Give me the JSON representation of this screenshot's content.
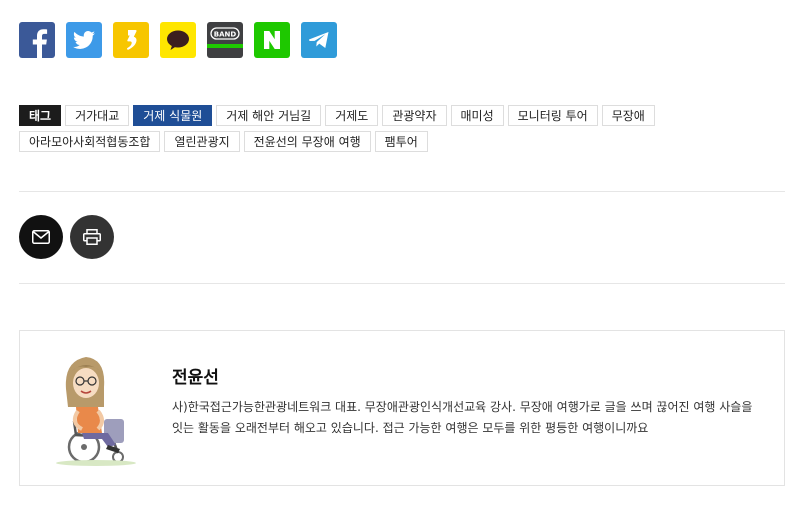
{
  "share": {
    "buttons": [
      {
        "name": "facebook",
        "icon": "facebook-icon"
      },
      {
        "name": "twitter",
        "icon": "twitter-icon"
      },
      {
        "name": "kakaostory",
        "icon": "kakaostory-icon"
      },
      {
        "name": "kakaotalk",
        "icon": "kakaotalk-icon"
      },
      {
        "name": "band",
        "icon": "band-icon",
        "text": "BAND"
      },
      {
        "name": "naver",
        "icon": "naver-icon",
        "text": "N"
      },
      {
        "name": "telegram",
        "icon": "telegram-icon"
      }
    ]
  },
  "tags": {
    "label": "태그",
    "items": [
      {
        "text": "거가대교",
        "active": false
      },
      {
        "text": "거제 식물원",
        "active": true
      },
      {
        "text": "거제 해안 거님길",
        "active": false
      },
      {
        "text": "거제도",
        "active": false
      },
      {
        "text": "관광약자",
        "active": false
      },
      {
        "text": "매미성",
        "active": false
      },
      {
        "text": "모니터링 투어",
        "active": false
      },
      {
        "text": "무장애",
        "active": false
      },
      {
        "text": "아라모아사회적협동조합",
        "active": false
      },
      {
        "text": "열린관광지",
        "active": false
      },
      {
        "text": "전윤선의 무장애 여행",
        "active": false
      },
      {
        "text": "팸투어",
        "active": false
      }
    ]
  },
  "actions": {
    "email_icon": "envelope-icon",
    "print_icon": "printer-icon"
  },
  "author": {
    "name": "전윤선",
    "bio": "사)한국접근가능한관광네트워크 대표. 무장애관광인식개선교육 강사. 무장애 여행가로 글을 쓰며 끊어진 여행 사슬을 잇는 활동을 오래전부터 해오고 있습니다. 접근 가능한 여행은 모두를 위한 평등한 여행이니까요"
  },
  "colors": {
    "facebook": "#3b5998",
    "twitter": "#3d9ae8",
    "kakaostory": "#f7c600",
    "kakaotalk": "#ffe600",
    "band": "#3f4042",
    "naver": "#1ec800",
    "telegram": "#2f9bd9",
    "tag_active": "#1f4e96",
    "tag_label": "#1c1c1c"
  }
}
